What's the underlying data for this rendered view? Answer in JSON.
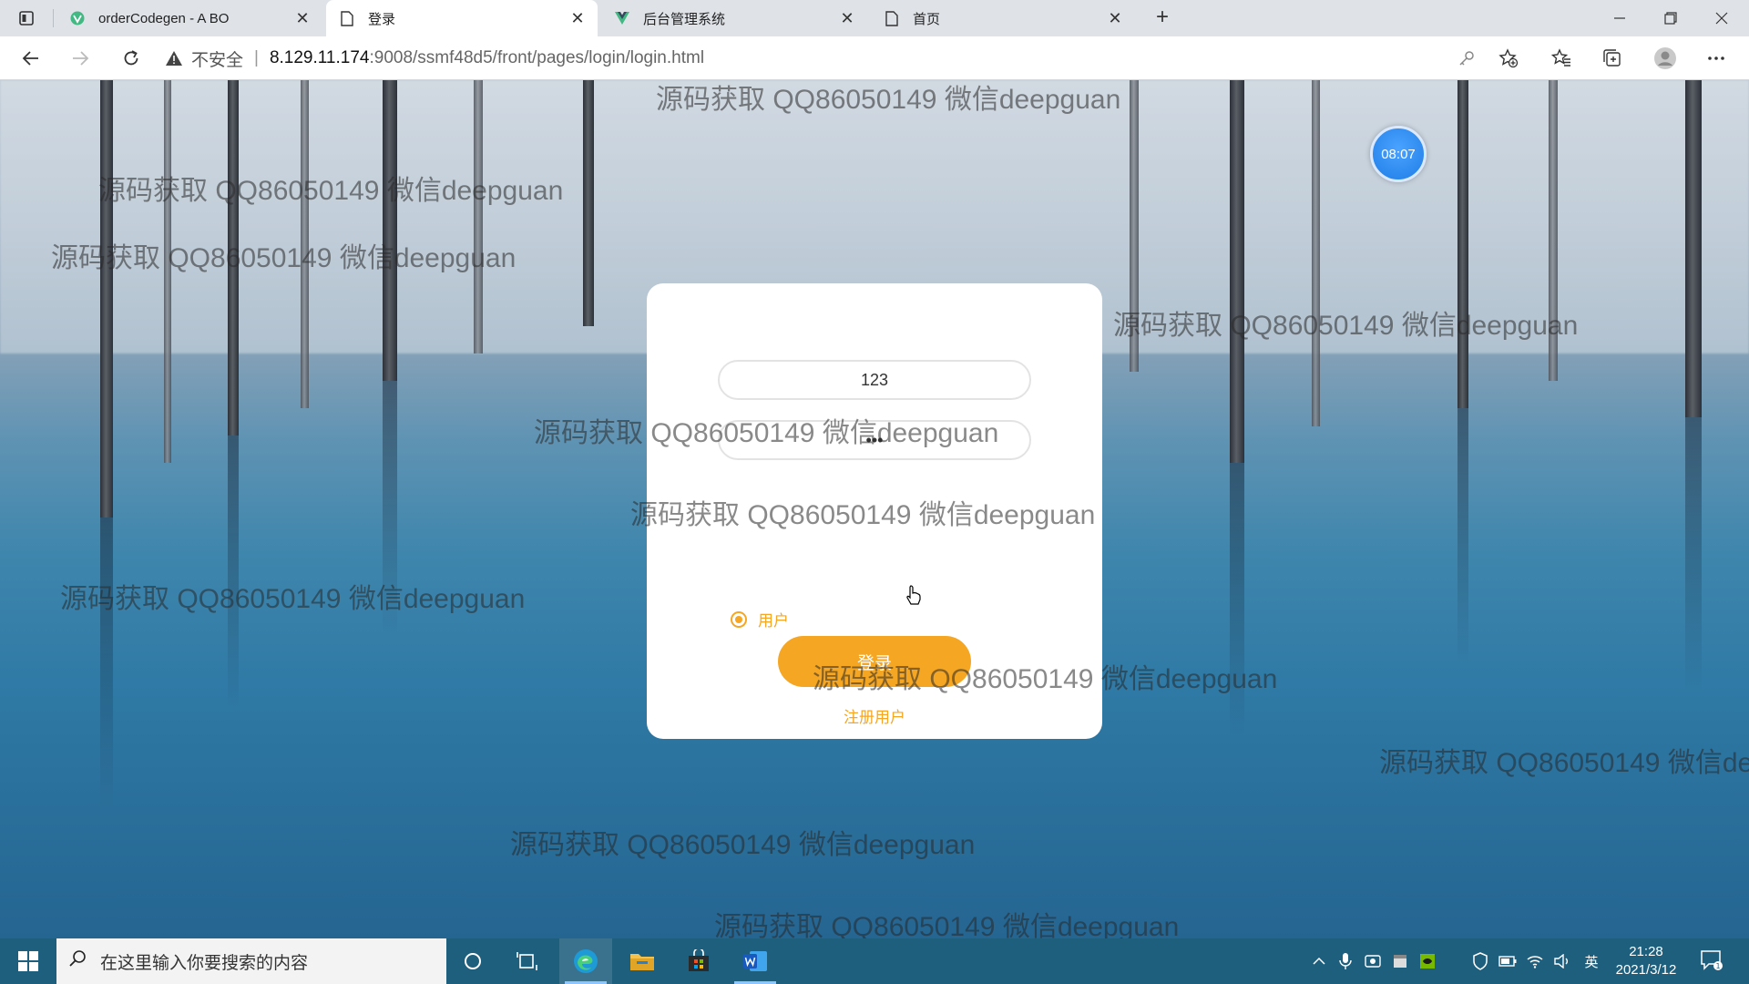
{
  "browser": {
    "tabs": [
      {
        "title": "orderCodegen - A BO",
        "active": false
      },
      {
        "title": "登录",
        "active": true
      },
      {
        "title": "后台管理系统",
        "active": false
      },
      {
        "title": "首页",
        "active": false
      }
    ],
    "address": {
      "insecure_label": "不安全",
      "host": "8.129.11.174",
      "path": ":9008/ssmf48d5/front/pages/login/login.html"
    }
  },
  "page": {
    "clock_badge": "08:07",
    "login": {
      "username_value": "123",
      "password_value": "•••",
      "role_option": "用户",
      "login_button": "登录",
      "register_link": "注册用户"
    },
    "watermark_text": "源码获取 QQ86050149 微信deepguan",
    "accent_color": "#f5a623"
  },
  "taskbar": {
    "search_placeholder": "在这里输入你要搜索的内容",
    "ime_label": "英",
    "time": "21:28",
    "date": "2021/3/12"
  }
}
